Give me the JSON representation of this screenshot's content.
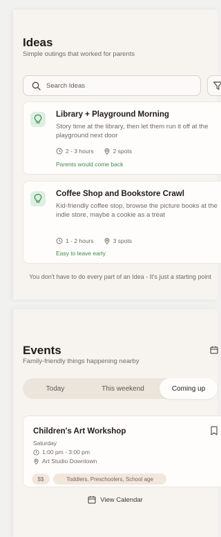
{
  "ideas": {
    "title": "Ideas",
    "subtitle": "Simple outings that worked for parents",
    "search_placeholder": "Search Ideas",
    "items": [
      {
        "title": "Library + Playground Morning",
        "description": "Story time at the library, then let them run it off at the playground next door",
        "duration": "2 - 3 hours",
        "spots": "2 spots",
        "note": "Parents would come back"
      },
      {
        "title": "Coffee Shop and Bookstore Crawl",
        "description": "Kid-friendly coffee stop, browse the picture books at the indie store, maybe a cookie as a treat",
        "duration": "1 - 2 hours",
        "spots": "3 spots",
        "note": "Easy to leave early"
      }
    ],
    "footer": "You don't have to do every part of an Idea - It's just a starting point"
  },
  "events": {
    "title": "Events",
    "subtitle": "Family-friendly things happening nearby",
    "tabs": [
      {
        "label": "Today",
        "active": false
      },
      {
        "label": "This weekend",
        "active": false
      },
      {
        "label": "Coming up",
        "active": true
      }
    ],
    "event": {
      "title": "Children's Art Workshop",
      "day": "Saturday",
      "time": "1:00 pm - 3:00 pm",
      "location": "Art Studio Downtown",
      "price": "$$",
      "ages": "Toddlers, Preschoolers, School age"
    },
    "view_calendar": "View Calendar"
  },
  "colors": {
    "accent_green": "#3f8b52",
    "bulb_bg": "#dcefe1",
    "panel_bg": "#f7f4ef"
  },
  "icons": [
    "search-icon",
    "filter-icon",
    "lightbulb-icon",
    "clock-icon",
    "location-pin-icon",
    "calendar-icon",
    "bookmark-icon"
  ]
}
